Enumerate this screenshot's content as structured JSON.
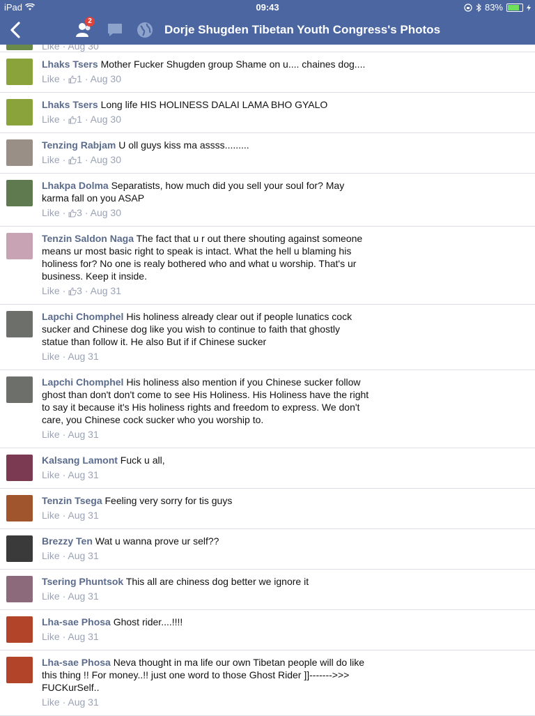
{
  "status_bar": {
    "device": "iPad",
    "time": "09:43",
    "battery": "83%"
  },
  "navbar": {
    "title": "Dorje Shugden Tibetan Youth Congress's Photos",
    "friend_requests_badge": "2"
  },
  "partial_comment": {
    "like": "Like",
    "date": "Aug 30"
  },
  "comments": [
    {
      "author": "Lhaks Tsers",
      "text": "Mother Fucker Shugden group Shame on u.... chaines dog....",
      "like": "Like",
      "likes": "1",
      "date": "Aug 30",
      "avatar": "#8aa33b"
    },
    {
      "author": "Lhaks Tsers",
      "text": "Long life HIS HOLINESS DALAI LAMA BHO GYALO",
      "like": "Like",
      "likes": "1",
      "date": "Aug 30",
      "avatar": "#8aa33b"
    },
    {
      "author": "Tenzing Rabjam",
      "text": "U oll guys kiss ma assss.........",
      "like": "Like",
      "likes": "1",
      "date": "Aug 30",
      "avatar": "#9a8f86"
    },
    {
      "author": "Lhakpa Dolma",
      "text": "Separatists, how much did you sell your soul for? May karma fall on you ASAP",
      "like": "Like",
      "likes": "3",
      "date": "Aug 30",
      "avatar": "#5f7a4e"
    },
    {
      "author": "Tenzin Saldon Naga",
      "text": "The fact that u r out there shouting against someone means ur most basic right to speak is intact. What the hell u blaming his holiness for? No one is realy bothered who and what u worship. That's ur business. Keep it inside.",
      "like": "Like",
      "likes": "3",
      "date": "Aug 31",
      "avatar": "#c8a3b4"
    },
    {
      "author": "Lapchi Chomphel",
      "text": "His holiness already clear out if people lunatics cock sucker and Chinese dog like you wish to continue to faith that ghostly statue than follow it. He also But if if Chinese sucker",
      "like": "Like",
      "likes": "",
      "date": "Aug 31",
      "avatar": "#6c6f6a"
    },
    {
      "author": "Lapchi Chomphel",
      "text": "His holiness also mention if you Chinese sucker follow ghost than don't don't come to see His Holiness. His Holiness have the right to say it because it's His holiness rights and freedom to express. We don't care, you Chinese cock sucker who you worship to.",
      "like": "Like",
      "likes": "",
      "date": "Aug 31",
      "avatar": "#6c6f6a"
    },
    {
      "author": "Kalsang Lamont",
      "text": "Fuck u all,",
      "like": "Like",
      "likes": "",
      "date": "Aug 31",
      "avatar": "#7b3a52"
    },
    {
      "author": "Tenzin Tsega",
      "text": "Feeling very sorry for tis guys",
      "like": "Like",
      "likes": "",
      "date": "Aug 31",
      "avatar": "#a0552c"
    },
    {
      "author": "Brezzy Ten",
      "text": "Wat u wanna prove ur self??",
      "like": "Like",
      "likes": "",
      "date": "Aug 31",
      "avatar": "#3a3a3a"
    },
    {
      "author": "Tsering Phuntsok",
      "text": "This all are chiness dog better we ignore it",
      "like": "Like",
      "likes": "",
      "date": "Aug 31",
      "avatar": "#8c6a7c"
    },
    {
      "author": "Lha-sae Phosa",
      "text": "Ghost rider....!!!!",
      "like": "Like",
      "likes": "",
      "date": "Aug 31",
      "avatar": "#b2442a"
    },
    {
      "author": "Lha-sae Phosa",
      "text": "Neva thought in ma life our own Tibetan people will do like this thing !! For money..!! just one word to those Ghost Rider ]]------->>> FUCKurSelf..",
      "like": "Like",
      "likes": "",
      "date": "Aug 31",
      "avatar": "#b2442a"
    }
  ]
}
